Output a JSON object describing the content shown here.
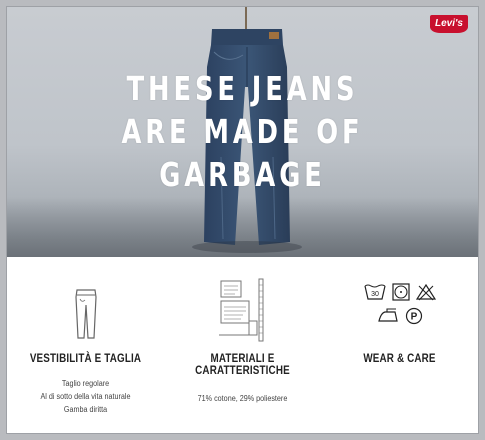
{
  "hero": {
    "headline_lines": [
      "THESE JEANS",
      "ARE MADE OF",
      "GARBAGE"
    ],
    "logo_text": "Levi's",
    "logo_color": "#c8102e"
  },
  "columns": [
    {
      "title": "VESTIBILITÀ E TAGLIA",
      "icon": "jeans-fit-icon",
      "lines": [
        "Taglio regolare",
        "Al di sotto della vita naturale",
        "Gamba diritta"
      ]
    },
    {
      "title_lines": [
        "MATERIALI E",
        "CARATTERISTICHE"
      ],
      "icon": "fabric-tag-icon",
      "lines": [
        "71% cotone, 29% poliestere"
      ]
    },
    {
      "title": "WEAR & CARE",
      "icons": [
        "wash-30-icon",
        "tumble-dry-icon",
        "no-bleach-icon",
        "iron-icon",
        "dry-clean-p-icon"
      ],
      "wash_temp": "30",
      "dry_clean_letter": "P"
    }
  ]
}
